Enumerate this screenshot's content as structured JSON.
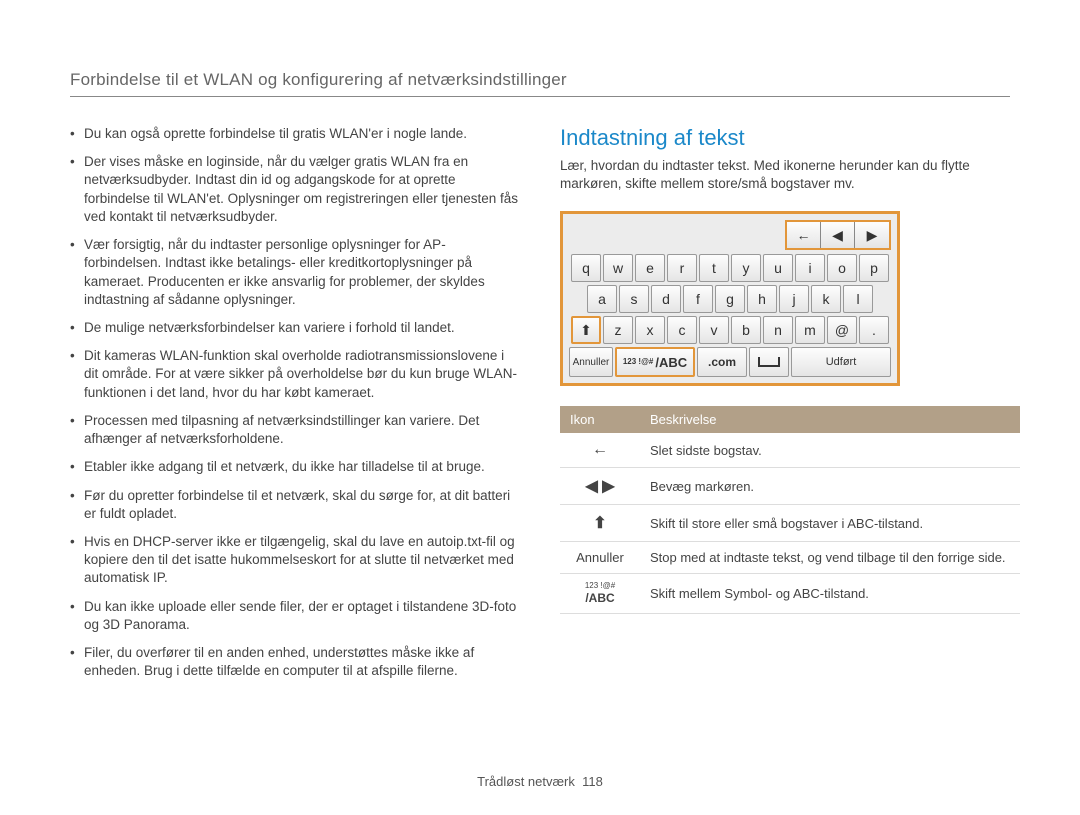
{
  "breadcrumb": "Forbindelse til et WLAN og konfigurering af netværksindstillinger",
  "footer": {
    "label": "Trådløst netværk",
    "page": "118"
  },
  "left_bullets": [
    "Du kan også oprette forbindelse til gratis WLAN'er i nogle lande.",
    "Der vises måske en loginside, når du vælger gratis WLAN fra en netværksudbyder. Indtast din id og adgangskode for at oprette forbindelse til WLAN'et. Oplysninger om registreringen eller tjenesten fås ved kontakt til netværksudbyder.",
    "Vær forsigtig, når du indtaster personlige oplysninger for AP-forbindelsen. Indtast ikke betalings- eller kreditkortoplysninger på kameraet. Producenten er ikke ansvarlig for problemer, der skyldes indtastning af sådanne oplysninger.",
    "De mulige netværksforbindelser kan variere i forhold til landet.",
    "Dit kameras WLAN-funktion skal overholde radiotransmissionslovene i dit område. For at være sikker på overholdelse bør du kun bruge WLAN-funktionen i det land, hvor du har købt kameraet.",
    "Processen med tilpasning af netværksindstillinger kan variere. Det afhænger af netværksforholdene.",
    "Etabler ikke adgang til et netværk, du ikke har tilladelse til at bruge.",
    "Før du opretter forbindelse til et netværk, skal du sørge for, at dit batteri er fuldt opladet.",
    "Hvis en DHCP-server ikke er tilgængelig, skal du lave en autoip.txt-fil og kopiere den til det isatte hukommelseskort for at slutte til netværket med automatisk IP.",
    "Du kan ikke uploade eller sende filer, der er optaget i tilstandene 3D-foto og 3D Panorama.",
    "Filer, du overfører til en anden enhed, understøttes måske ikke af enheden. Brug i dette tilfælde en computer til at afspille filerne."
  ],
  "right": {
    "heading": "Indtastning af tekst",
    "lead": "Lær, hvordan du indtaster tekst. Med ikonerne herunder kan du flytte markøren, skifte mellem store/små bogstaver mv.",
    "keyboard": {
      "nav": {
        "back": "←",
        "left": "◀",
        "right": "▶"
      },
      "row1": [
        "q",
        "w",
        "e",
        "r",
        "t",
        "y",
        "u",
        "i",
        "o",
        "p"
      ],
      "row2": [
        "a",
        "s",
        "d",
        "f",
        "g",
        "h",
        "j",
        "k",
        "l"
      ],
      "row3_shift": "⬆",
      "row3": [
        "z",
        "x",
        "c",
        "v",
        "b",
        "n",
        "m",
        "@",
        "."
      ],
      "bottom": {
        "cancel": "Annuller",
        "mode_sym": "123\n!@#",
        "mode_abc": "/ABC",
        "com": ".com",
        "done": "Udført"
      }
    },
    "legend": {
      "headers": [
        "Ikon",
        "Beskrivelse"
      ],
      "rows": [
        {
          "icon": "←",
          "desc": "Slet sidste bogstav."
        },
        {
          "icon": "◀ ▶",
          "desc": "Bevæg markøren."
        },
        {
          "icon": "⬆",
          "desc": "Skift til store eller små bogstaver i ABC-tilstand."
        },
        {
          "icon": "Annuller",
          "desc": "Stop med at indtaste tekst, og vend tilbage til den forrige side."
        },
        {
          "icon_mode": {
            "sym": "123 !@#",
            "abc": "/ABC"
          },
          "desc": "Skift mellem Symbol- og ABC-tilstand."
        }
      ]
    }
  }
}
